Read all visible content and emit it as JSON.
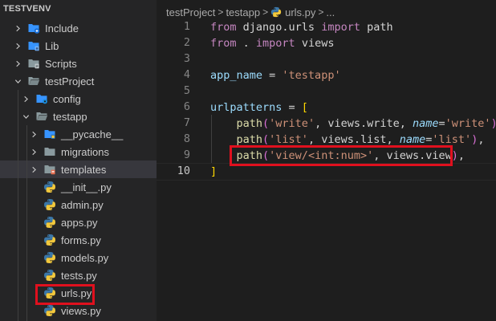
{
  "explorer": {
    "root": "TESTVENV",
    "items": [
      {
        "label": "Include",
        "kind": "folder",
        "icon": "include-folder-icon",
        "color": "#3794ff"
      },
      {
        "label": "Lib",
        "kind": "folder",
        "icon": "lib-folder-icon",
        "color": "#3794ff"
      },
      {
        "label": "Scripts",
        "kind": "folder",
        "icon": "scripts-folder-icon",
        "color": "#8a9a9e"
      },
      {
        "label": "testProject",
        "kind": "folder-open",
        "icon": "open-folder-icon",
        "color": "#8a9a9e"
      },
      {
        "label": "config",
        "kind": "folder",
        "icon": "config-folder-icon",
        "color": "#3794ff"
      },
      {
        "label": "testapp",
        "kind": "folder-open",
        "icon": "open-folder-icon",
        "color": "#8a9a9e"
      },
      {
        "label": "__pycache__",
        "kind": "folder",
        "icon": "pycache-folder-icon",
        "color": "#3794ff"
      },
      {
        "label": "migrations",
        "kind": "folder",
        "icon": "folder-icon",
        "color": "#8a9a9e"
      },
      {
        "label": "templates",
        "kind": "folder",
        "icon": "templates-folder-icon",
        "color": "#8a9a9e"
      },
      {
        "label": "__init__.py",
        "kind": "file",
        "icon": "python-file-icon"
      },
      {
        "label": "admin.py",
        "kind": "file",
        "icon": "python-file-icon"
      },
      {
        "label": "apps.py",
        "kind": "file",
        "icon": "python-file-icon"
      },
      {
        "label": "forms.py",
        "kind": "file",
        "icon": "python-file-icon"
      },
      {
        "label": "models.py",
        "kind": "file",
        "icon": "python-file-icon"
      },
      {
        "label": "tests.py",
        "kind": "file",
        "icon": "python-file-icon"
      },
      {
        "label": "urls.py",
        "kind": "file",
        "icon": "python-file-icon"
      },
      {
        "label": "views.py",
        "kind": "file",
        "icon": "python-file-icon"
      }
    ]
  },
  "breadcrumb": {
    "parts": [
      "testProject",
      "testapp",
      "urls.py",
      "..."
    ],
    "separator": ">"
  },
  "editor": {
    "active_line": 10,
    "lines": [
      {
        "n": "1",
        "tokens": [
          [
            "kw",
            "from"
          ],
          [
            "plain",
            " django.urls "
          ],
          [
            "kw",
            "import"
          ],
          [
            "plain",
            " path"
          ]
        ]
      },
      {
        "n": "2",
        "tokens": [
          [
            "kw",
            "from"
          ],
          [
            "plain",
            " . "
          ],
          [
            "kw",
            "import"
          ],
          [
            "plain",
            " views"
          ]
        ]
      },
      {
        "n": "3",
        "tokens": []
      },
      {
        "n": "4",
        "tokens": [
          [
            "var",
            "app_name"
          ],
          [
            "plain",
            " = "
          ],
          [
            "str",
            "'testapp'"
          ]
        ]
      },
      {
        "n": "5",
        "tokens": []
      },
      {
        "n": "6",
        "tokens": [
          [
            "var",
            "urlpatterns"
          ],
          [
            "plain",
            " = "
          ],
          [
            "br1",
            "["
          ]
        ]
      },
      {
        "n": "7",
        "tokens": [
          [
            "plain",
            "    "
          ],
          [
            "fn",
            "path"
          ],
          [
            "br2",
            "("
          ],
          [
            "str",
            "'write'"
          ],
          [
            "plain",
            ", views.write, "
          ],
          [
            "param",
            "name"
          ],
          [
            "plain",
            "="
          ],
          [
            "str",
            "'write'"
          ],
          [
            "br2",
            ")"
          ],
          [
            "plain",
            ","
          ]
        ]
      },
      {
        "n": "8",
        "tokens": [
          [
            "plain",
            "    "
          ],
          [
            "fn",
            "path"
          ],
          [
            "br2",
            "("
          ],
          [
            "str",
            "'list'"
          ],
          [
            "plain",
            ", views.list, "
          ],
          [
            "param",
            "name"
          ],
          [
            "plain",
            "="
          ],
          [
            "str",
            "'list'"
          ],
          [
            "br2",
            ")"
          ],
          [
            "plain",
            ","
          ]
        ]
      },
      {
        "n": "9",
        "tokens": [
          [
            "plain",
            "    "
          ],
          [
            "fn",
            "path"
          ],
          [
            "br2",
            "("
          ],
          [
            "str",
            "'view/<int:num>'"
          ],
          [
            "plain",
            ", views.view"
          ],
          [
            "br2",
            ")"
          ],
          [
            "plain",
            ","
          ]
        ]
      },
      {
        "n": "10",
        "tokens": [
          [
            "br1",
            "]"
          ]
        ]
      }
    ]
  },
  "colors": {
    "highlight": "#e0101e",
    "sidebar_bg": "#252526",
    "editor_bg": "#1e1e1e",
    "keyword": "#c586c0",
    "string": "#ce9178",
    "function": "#dcdcaa",
    "variable": "#9cdcfe"
  }
}
